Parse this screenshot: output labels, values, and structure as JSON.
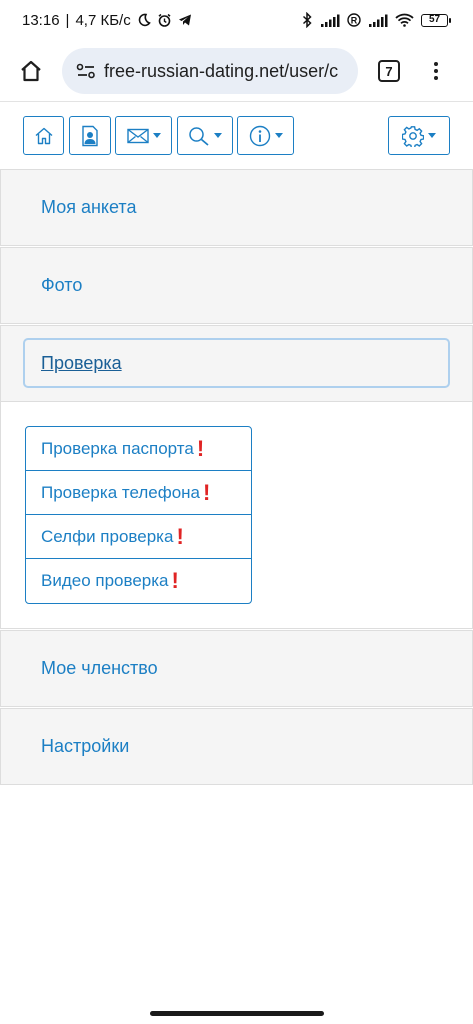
{
  "status_bar": {
    "time": "13:16",
    "speed": "4,7 КБ/с",
    "battery": "57",
    "icons": [
      "moon-icon",
      "alarm-icon",
      "telegram-icon",
      "bluetooth-icon",
      "signal-icon",
      "roaming-icon",
      "signal-icon",
      "wifi-icon",
      "battery-icon"
    ]
  },
  "browser": {
    "url": "free-russian-dating.net/user/c",
    "tab_count": "7",
    "icons": [
      "home-icon",
      "site-info-icon",
      "tabs-icon",
      "more-vert-icon"
    ]
  },
  "toolbar": {
    "buttons": [
      {
        "name": "home",
        "icon": "house-icon",
        "dropdown": false
      },
      {
        "name": "profile",
        "icon": "profile-card-icon",
        "dropdown": false
      },
      {
        "name": "mail",
        "icon": "envelope-icon",
        "dropdown": true
      },
      {
        "name": "search",
        "icon": "magnifier-icon",
        "dropdown": true
      },
      {
        "name": "info",
        "icon": "info-icon",
        "dropdown": true
      },
      {
        "name": "settings",
        "icon": "gear-icon",
        "dropdown": true
      }
    ]
  },
  "accordion": {
    "items": [
      {
        "label": "Моя анкета"
      },
      {
        "label": "Фото"
      },
      {
        "label": "Проверка",
        "active": true
      },
      {
        "label": "Мое членство"
      },
      {
        "label": "Настройки"
      }
    ],
    "verification_items": [
      {
        "label": "Проверка паспорта",
        "mark": "!"
      },
      {
        "label": "Проверка телефона",
        "mark": "!"
      },
      {
        "label": "Селфи проверка",
        "mark": "!"
      },
      {
        "label": "Видео проверка",
        "mark": "!"
      }
    ]
  },
  "colors": {
    "link": "#1c7fc4",
    "alert": "#e02424",
    "panel_bg": "#f5f5f5",
    "url_bar_bg": "#e9eef6"
  }
}
